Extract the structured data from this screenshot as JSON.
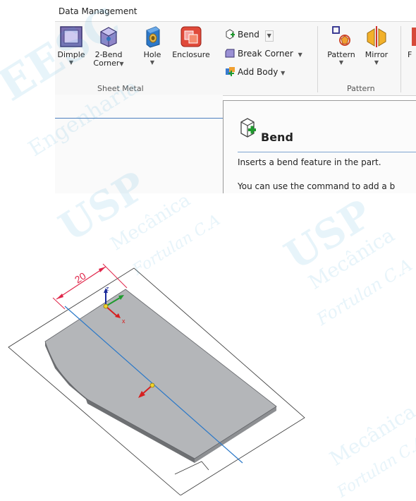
{
  "tabs": {
    "data_management": "Data Management"
  },
  "ribbon": {
    "sheet_metal": {
      "group_label": "Sheet Metal",
      "dimple": "Dimple",
      "two_bend_corner_line1": "2-Bend",
      "two_bend_corner_line2": "Corner",
      "hole": "Hole",
      "enclosure": "Enclosure",
      "bend": "Bend",
      "break_corner": "Break Corner",
      "add_body": "Add Body"
    },
    "pattern": {
      "group_label": "Pattern",
      "pattern": "Pattern",
      "mirror": "Mirror"
    },
    "overflow_label": "F"
  },
  "tooltip": {
    "title": "Bend",
    "description": "Inserts a bend feature in the part.",
    "more": "You can use the command to add a b"
  },
  "viewport": {
    "dimension": "20",
    "axis_z": "z",
    "axis_x": "x"
  },
  "watermark": {
    "lines": [
      "EESC",
      "Engenharia",
      "USP",
      "Mecânica",
      "Fortulan C.A",
      "USP",
      "Mecânica",
      "Fortulan C.A",
      "Mecânica",
      "Fortulan C.A"
    ]
  },
  "colors": {
    "accent_blue": "#2a78c8",
    "plate_fill": "#b4b6b9",
    "dimension_red": "#e0264a"
  }
}
